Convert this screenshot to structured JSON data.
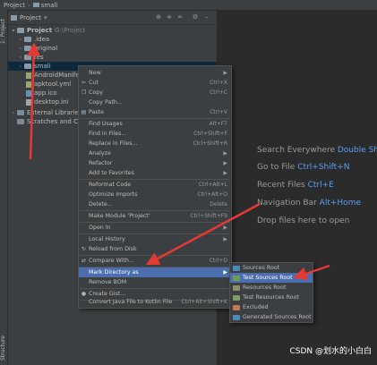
{
  "breadcrumb": [
    "Project",
    "smali"
  ],
  "tool_strip": {
    "top_label": "1: Project",
    "bottom_label": "Structure"
  },
  "panel": {
    "title": "Project"
  },
  "tree": [
    {
      "label": "Project",
      "suffix": "G:\\Project",
      "kind": "folder",
      "expanded": true,
      "depth": 0
    },
    {
      "label": ".idea",
      "kind": "folder",
      "depth": 1
    },
    {
      "label": "original",
      "kind": "folder",
      "depth": 1
    },
    {
      "label": "res",
      "kind": "folder",
      "depth": 1
    },
    {
      "label": "smali",
      "kind": "folder",
      "depth": 1,
      "selected": true
    },
    {
      "label": "AndroidManifes",
      "kind": "file",
      "depth": 1
    },
    {
      "label": "apktool.yml",
      "kind": "file",
      "depth": 1
    },
    {
      "label": "app.ico",
      "kind": "file",
      "depth": 1
    },
    {
      "label": "desktop.ini",
      "kind": "file",
      "depth": 1
    },
    {
      "label": "External Libraries",
      "kind": "folder",
      "depth": 0
    },
    {
      "label": "Scratches and Con",
      "kind": "folder",
      "depth": 0
    }
  ],
  "context_menu": [
    {
      "label": "New",
      "shortcut": "",
      "submenu": true,
      "icon": ""
    },
    {
      "label": "Cut",
      "shortcut": "Ctrl+X",
      "icon": "cut-icon"
    },
    {
      "label": "Copy",
      "shortcut": "Ctrl+C",
      "icon": "copy-icon"
    },
    {
      "label": "Copy Path...",
      "shortcut": ""
    },
    {
      "label": "Paste",
      "shortcut": "Ctrl+V",
      "icon": "paste-icon",
      "sep_after": true
    },
    {
      "label": "Find Usages",
      "shortcut": "Alt+F7"
    },
    {
      "label": "Find in Files...",
      "shortcut": "Ctrl+Shift+F"
    },
    {
      "label": "Replace in Files...",
      "shortcut": "Ctrl+Shift+R"
    },
    {
      "label": "Analyze",
      "shortcut": "",
      "submenu": true
    },
    {
      "label": "Refactor",
      "shortcut": "",
      "submenu": true
    },
    {
      "label": "Add to Favorites",
      "shortcut": "",
      "submenu": true,
      "sep_after": true
    },
    {
      "label": "Reformat Code",
      "shortcut": "Ctrl+Alt+L"
    },
    {
      "label": "Optimize Imports",
      "shortcut": "Ctrl+Alt+O"
    },
    {
      "label": "Delete...",
      "shortcut": "Delete",
      "sep_after": true
    },
    {
      "label": "Make Module 'Project'",
      "shortcut": "Ctrl+Shift+F9",
      "sep_after": true
    },
    {
      "label": "Open In",
      "shortcut": "",
      "submenu": true,
      "sep_after": true
    },
    {
      "label": "Local History",
      "shortcut": "",
      "submenu": true
    },
    {
      "label": "Reload from Disk",
      "shortcut": "",
      "icon": "reload-icon",
      "sep_after": true
    },
    {
      "label": "Compare With...",
      "shortcut": "Ctrl+D",
      "icon": "compare-icon",
      "sep_after": true
    },
    {
      "label": "Mark Directory as",
      "shortcut": "",
      "submenu": true,
      "active": true
    },
    {
      "label": "Remove BOM",
      "shortcut": "",
      "sep_after": true
    },
    {
      "label": "Create Gist...",
      "shortcut": "",
      "icon": "github-icon",
      "sep_after": true
    },
    {
      "label": "Convert Java File to Kotlin File",
      "shortcut": "Ctrl+Alt+Shift+K"
    }
  ],
  "submenu_mark_directory": [
    {
      "label": "Sources Root",
      "color": "#4a8ab5"
    },
    {
      "label": "Test Sources Root",
      "color": "#6a9f5b",
      "active": true
    },
    {
      "label": "Resources Root",
      "color": "#8a8f6e"
    },
    {
      "label": "Test Resources Root",
      "color": "#7d9c6a"
    },
    {
      "label": "Excluded",
      "color": "#c27a55"
    },
    {
      "label": "Generated Sources Root",
      "color": "#4a8ab5"
    }
  ],
  "tips": [
    {
      "text": "Search Everywhere",
      "shortcut": "Double Shift"
    },
    {
      "text": "Go to File",
      "shortcut": "Ctrl+Shift+N"
    },
    {
      "text": "Recent Files",
      "shortcut": "Ctrl+E"
    },
    {
      "text": "Navigation Bar",
      "shortcut": "Alt+Home"
    },
    {
      "text": "Drop files here to open",
      "shortcut": ""
    }
  ],
  "watermark": "CSDN @划水的小白白",
  "accent_colors": {
    "selection": "#4b6eaf",
    "annotation_arrow": "#e53935",
    "link": "#589df6"
  }
}
